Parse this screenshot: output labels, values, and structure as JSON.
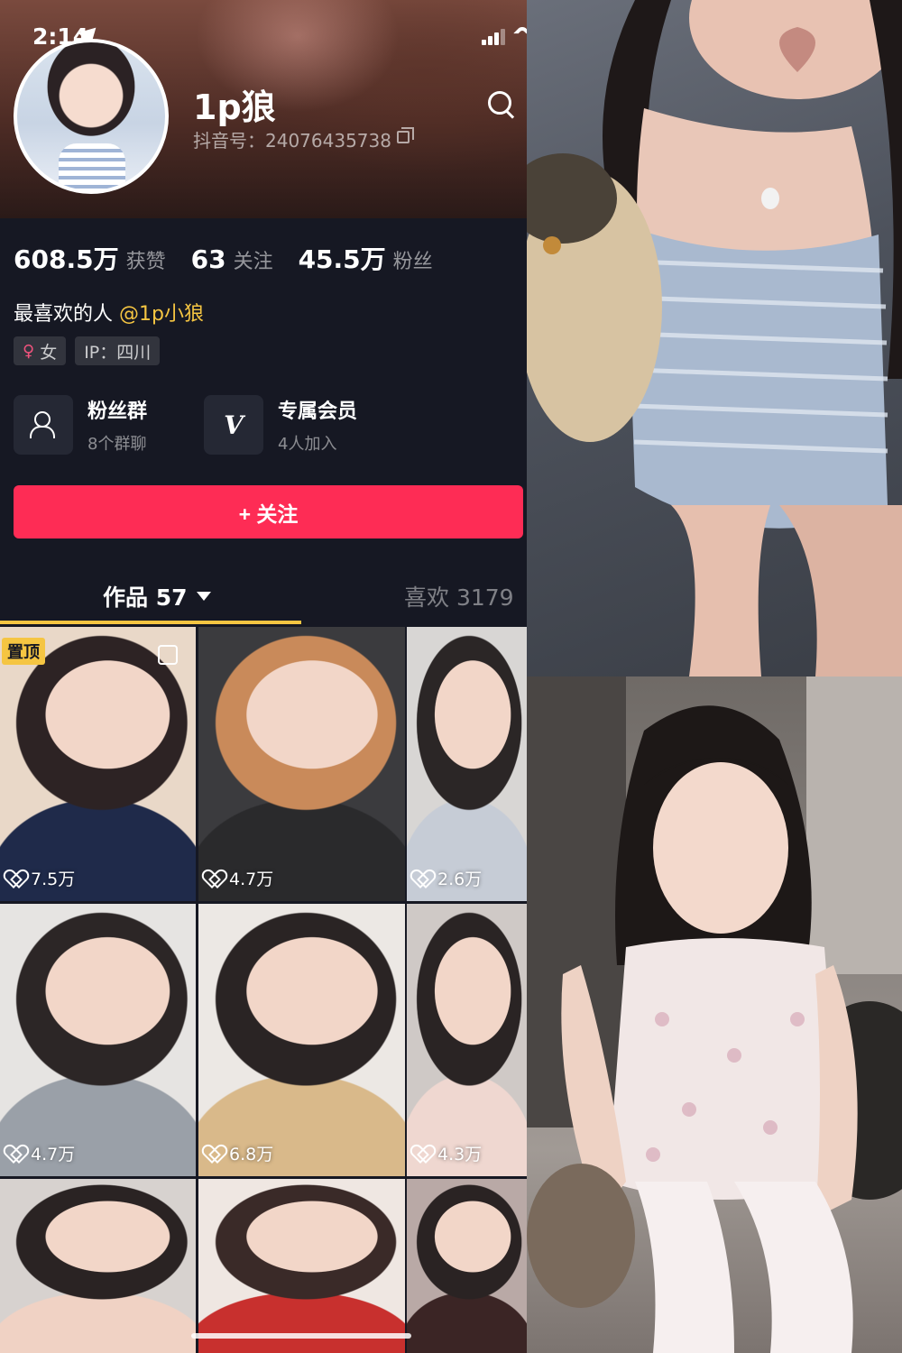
{
  "status_bar": {
    "time": "2:14"
  },
  "profile": {
    "nickname": "1p狼",
    "douyin_id": "抖音号：24076435738",
    "stats": [
      {
        "num": "608.5万",
        "label": "获赞"
      },
      {
        "num": "63",
        "label": "关注"
      },
      {
        "num": "45.5万",
        "label": "粉丝"
      }
    ],
    "bio_prefix": "最喜欢的人 ",
    "bio_mention": "@1p小狼",
    "tags": [
      {
        "icon": "♀",
        "label": "女"
      },
      {
        "label": "IP：四川"
      }
    ],
    "cards": [
      {
        "title": "粉丝群",
        "sub": "8个群聊",
        "icon": "fan-group-icon"
      },
      {
        "title": "专属会员",
        "sub": "4人加入",
        "icon": "v-member-icon"
      }
    ],
    "follow_label": "+ 关注"
  },
  "tabs": {
    "works": "作品 57",
    "likes": "喜欢 3179"
  },
  "videos": [
    {
      "likes": "7.5万",
      "pinned": "置顶",
      "palette": [
        "#e9d8c8",
        "#2d2324",
        "#1f2a4a"
      ]
    },
    {
      "likes": "4.7万",
      "palette": [
        "#3b3b3e",
        "#c98a5a",
        "#2a2a2c"
      ]
    },
    {
      "likes": "2.6万",
      "palette": [
        "#d8d6d4",
        "#2b2626",
        "#c6ccd6"
      ]
    },
    {
      "likes": "4.7万",
      "palette": [
        "#e6e4e2",
        "#2c2626",
        "#9aa0a8"
      ]
    },
    {
      "likes": "6.8万",
      "palette": [
        "#ece8e4",
        "#2a2424",
        "#d9b98a"
      ]
    },
    {
      "likes": "4.3万",
      "palette": [
        "#cfc9c6",
        "#2a2424",
        "#efd7d0"
      ]
    },
    {
      "likes": "",
      "palette": [
        "#d7d2cf",
        "#2a2323",
        "#f0d2c4"
      ]
    },
    {
      "likes": "",
      "palette": [
        "#efe7e2",
        "#3a2a28",
        "#c8302e"
      ]
    },
    {
      "likes": "",
      "palette": [
        "#b9a9a6",
        "#2a2323",
        "#3b2525"
      ]
    }
  ],
  "colors": {
    "accent": "#fe2c55",
    "mention": "#f5c542",
    "bg": "#161823"
  }
}
